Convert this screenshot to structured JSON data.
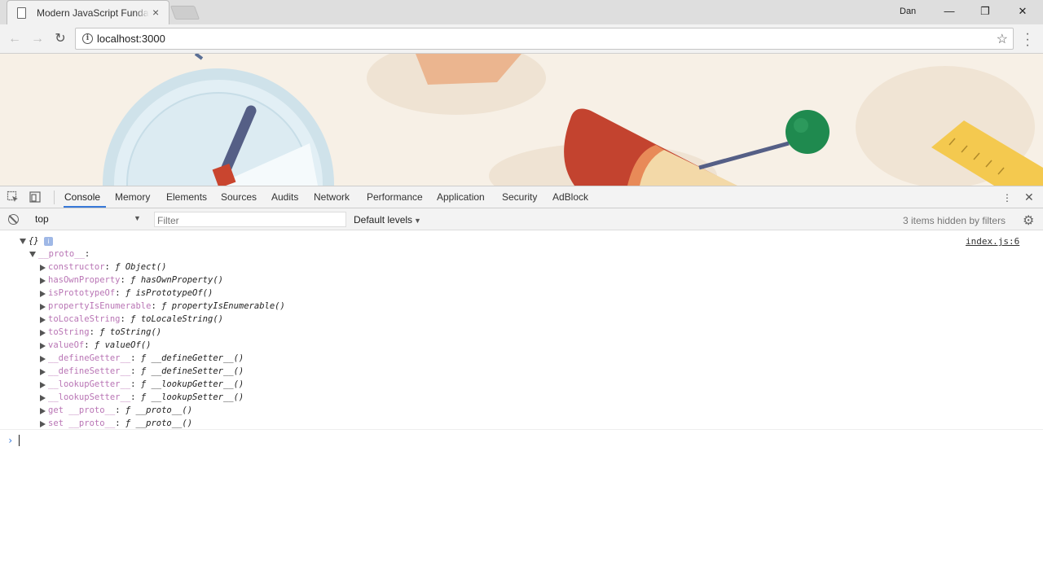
{
  "browser": {
    "tab_title": "Modern JavaScript Fundamentals",
    "tab_close": "×",
    "profile_name": "Dan",
    "url": "localhost:3000"
  },
  "devtools": {
    "tabs": [
      "Console",
      "Memory",
      "Elements",
      "Sources",
      "Audits",
      "Network",
      "Performance",
      "Application",
      "Security",
      "AdBlock"
    ],
    "active_tab": "Console",
    "context": "top",
    "filter_placeholder": "Filter",
    "levels": "Default levels",
    "hidden_message": "3 items hidden by filters"
  },
  "console": {
    "object_label": "{}",
    "info_badge": "i",
    "source": "index.js:6",
    "proto_label": "__proto__",
    "props": [
      {
        "key": "constructor",
        "value": "ƒ Object()"
      },
      {
        "key": "hasOwnProperty",
        "value": "ƒ hasOwnProperty()"
      },
      {
        "key": "isPrototypeOf",
        "value": "ƒ isPrototypeOf()"
      },
      {
        "key": "propertyIsEnumerable",
        "value": "ƒ propertyIsEnumerable()"
      },
      {
        "key": "toLocaleString",
        "value": "ƒ toLocaleString()"
      },
      {
        "key": "toString",
        "value": "ƒ toString()"
      },
      {
        "key": "valueOf",
        "value": "ƒ valueOf()"
      },
      {
        "key": "__defineGetter__",
        "value": "ƒ __defineGetter__()"
      },
      {
        "key": "__defineSetter__",
        "value": "ƒ __defineSetter__()"
      },
      {
        "key": "__lookupGetter__",
        "value": "ƒ __lookupGetter__()"
      },
      {
        "key": "__lookupSetter__",
        "value": "ƒ __lookupSetter__()"
      },
      {
        "key": "get __proto__",
        "value": "ƒ __proto__()"
      },
      {
        "key": "set __proto__",
        "value": "ƒ __proto__()"
      }
    ],
    "prompt": "›"
  },
  "colors": {
    "accent": "#3879d9",
    "property_key": "#b975b5",
    "page_background": "#f7f0e6"
  }
}
